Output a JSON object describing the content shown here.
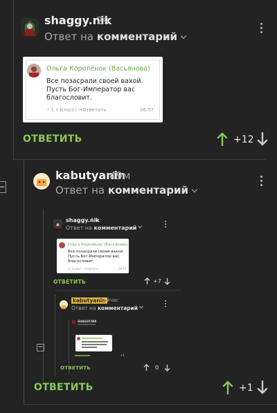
{
  "top_comment": {
    "username": "shaggy.nik",
    "time": "2ч",
    "reply_to_prefix": "Ответ на",
    "reply_to_target": "комментарий",
    "embedded": {
      "author": "Ольга Королёнок (Васьянова)",
      "text": "Все позасрали своей вахой. Пусть Бог-Император вас благословит.",
      "footer_count": "1",
      "footer_class": "Класс!",
      "footer_reply": "Ответить",
      "footer_time": "06:57"
    },
    "reply_label": "ОТВЕТИТЬ",
    "score": "+12"
  },
  "second_comment": {
    "username": "kabutyanin",
    "time": "49м",
    "reply_to_prefix": "Ответ на",
    "reply_to_target": "комментарий",
    "reply_label": "ОТВЕТИТЬ",
    "score": "+1",
    "collapse_symbol": "−",
    "nested": {
      "username": "shaggy.nik",
      "time": "1ч",
      "reply_to_prefix": "Ответ на",
      "reply_to_target": "комментарий",
      "embedded": {
        "author": "Ольга Королёнок (Васьянова)",
        "text": "Все позасрали своей вахой. Пусть Бог-Император вас благословит.",
        "footer": "1 · Класс! · Ответить",
        "footer_time": "06:57"
      },
      "reply_label": "ОТВЕТИТЬ",
      "score": "+7",
      "deep": {
        "username": "kabutyanin",
        "time": "сейчас",
        "reply_to_prefix": "Ответ на",
        "reply_to_target": "комментарий",
        "reply_label": "ОТВЕТИТЬ",
        "score": "0",
        "collapse_symbol": "−",
        "tiny": {
          "username": "SHAGGY.NIK",
          "score": "+1"
        }
      }
    }
  }
}
